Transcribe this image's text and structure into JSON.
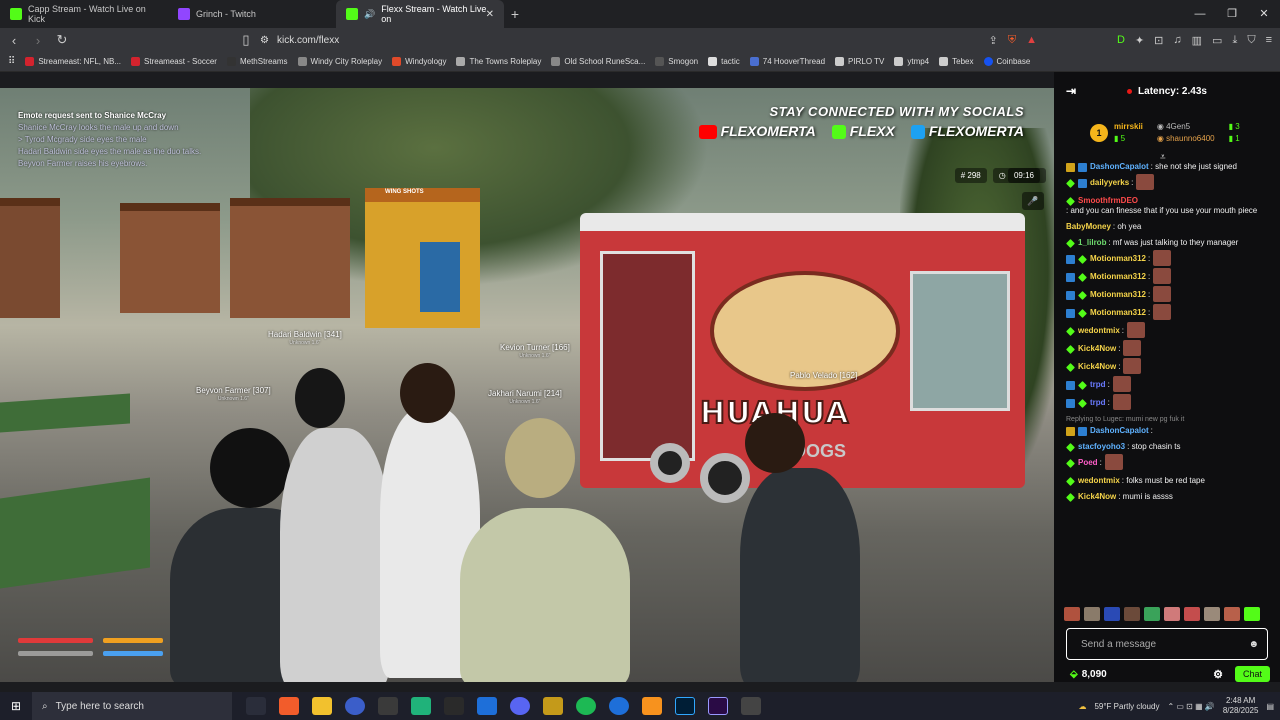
{
  "browser": {
    "tabs": [
      {
        "title": "Capp Stream - Watch Live on Kick",
        "favicon": "kick-icon"
      },
      {
        "title": "Grinch - Twitch",
        "favicon": "twitch-icon"
      },
      {
        "title": "Flexx Stream - Watch Live on",
        "favicon": "kick-icon"
      }
    ],
    "url": "kick.com/flexx",
    "bookmarks": [
      "Streameast: NFL, NB...",
      "Streameast - Soccer",
      "MethStreams",
      "Windy City Roleplay",
      "Windyology",
      "The Towns Roleplay",
      "Old School RuneSca...",
      "Smogon",
      "tactic",
      "74 HooverThread",
      "PIRLO TV",
      "ytmp4",
      "Tebex",
      "Coinbase"
    ]
  },
  "stream": {
    "notify_title": "Emote request sent to Shanice McCray",
    "notify_lines": [
      "Shanice McCray looks the male up and down",
      "> Tyrod Mcgrady side eyes the male",
      "Hadari Baldwin side eyes the male as the duo talks.",
      "Beyvon Farmer raises his eyebrows."
    ],
    "social_heading": "STAY CONNECTED WITH MY SOCIALS",
    "social_youtube": "FLEXOMERTA",
    "social_kick": "FLEXX",
    "social_x": "FLEXOMERTA",
    "hud_id": "# 298",
    "hud_time": "09:16",
    "truck_text": "HUAHUA",
    "truck_sub": "HOT DOGS",
    "kiosk_sign": "WING SHOTS",
    "name_tags": [
      {
        "name": "Hadari Baldwin [341]",
        "sub": "Unknown 1.6\""
      },
      {
        "name": "Kevion Turner [166]",
        "sub": "Unknown 1.6\""
      },
      {
        "name": "Beyvon Farmer [307]",
        "sub": "Unknown 1.6\""
      },
      {
        "name": "Jakhari Narumi [214]",
        "sub": "Unknown 1.6\""
      },
      {
        "name": "Pablo Velado [162]",
        "sub": ""
      }
    ]
  },
  "chat": {
    "latency": "Latency: 2.43s",
    "leaderboard": {
      "rank": "1",
      "user1": "mirrskii",
      "user1_count": "5",
      "user2": "4Gen5",
      "user2_count": "3",
      "user3": "shaunno6400",
      "user3_count": "1"
    },
    "messages": [
      {
        "user": "DashonCapalot",
        "text": ": she not she just signed",
        "color": "#5fb2ff",
        "badges": [
          "crown",
          "sub"
        ],
        "emote": false
      },
      {
        "user": "dailyyerks",
        "text": ":",
        "color": "#f5d44a",
        "badges": [
          "vip",
          "sub"
        ],
        "emote": true
      },
      {
        "user": "SmoothfrmDEO",
        "text": ": and you can finesse that if you use your mouth piece",
        "color": "#ff4b4b",
        "badges": [
          "vip"
        ],
        "emote": false
      },
      {
        "user": "BabyMoney",
        "text": ": oh yea",
        "color": "#f5d44a",
        "badges": [],
        "emote": false
      },
      {
        "user": "1_lilrob",
        "text": ": mf was just talking to they manager",
        "color": "#6fdc6f",
        "badges": [
          "vip"
        ],
        "emote": false
      },
      {
        "user": "Motionman312",
        "text": ":",
        "color": "#f5d44a",
        "badges": [
          "sub",
          "vip"
        ],
        "emote": true
      },
      {
        "user": "Motionman312",
        "text": ":",
        "color": "#f5d44a",
        "badges": [
          "sub",
          "vip"
        ],
        "emote": true
      },
      {
        "user": "Motionman312",
        "text": ":",
        "color": "#f5d44a",
        "badges": [
          "sub",
          "vip"
        ],
        "emote": true
      },
      {
        "user": "Motionman312",
        "text": ":",
        "color": "#f5d44a",
        "badges": [
          "sub",
          "vip"
        ],
        "emote": true
      },
      {
        "user": "wedontmix",
        "text": ":",
        "color": "#f5d44a",
        "badges": [
          "vip"
        ],
        "emote": true
      },
      {
        "user": "Kick4Now",
        "text": ":",
        "color": "#f5d44a",
        "badges": [
          "vip"
        ],
        "emote": true
      },
      {
        "user": "Kick4Now",
        "text": ":",
        "color": "#f5d44a",
        "badges": [
          "vip"
        ],
        "emote": true
      },
      {
        "user": "trpd",
        "text": ":",
        "color": "#6a7bff",
        "badges": [
          "sub",
          "vip"
        ],
        "emote": true
      },
      {
        "user": "trpd",
        "text": ":",
        "color": "#6a7bff",
        "badges": [
          "sub",
          "vip"
        ],
        "emote": true
      }
    ],
    "reply_note": "Replying to Lugec: mumi new pg fuk it",
    "messages2": [
      {
        "user": "DashonCapalot",
        "text": ":",
        "color": "#5fb2ff",
        "badges": [
          "crown",
          "sub"
        ],
        "emote": false
      },
      {
        "user": "stacfoyoho3",
        "text": ": stop chasin ts",
        "color": "#5fb2ff",
        "badges": [
          "vip"
        ],
        "emote": false
      },
      {
        "user": "Poed",
        "text": ":",
        "color": "#ff5ec8",
        "badges": [
          "vip"
        ],
        "emote": true
      },
      {
        "user": "wedontmix",
        "text": ": folks must be red tape",
        "color": "#f5d44a",
        "badges": [
          "vip"
        ],
        "emote": false
      },
      {
        "user": "Kick4Now",
        "text": ": mumi is assss",
        "color": "#f5d44a",
        "badges": [
          "vip"
        ],
        "emote": false
      }
    ],
    "input_placeholder": "Send a message",
    "points": "8,090",
    "chat_button": "Chat"
  },
  "taskbar": {
    "search_placeholder": "Type here to search",
    "weather": "59°F  Partly cloudy",
    "time": "2:48 AM",
    "date": "8/28/2025"
  },
  "colors": {
    "kick_green": "#53fc18",
    "chat_bg": "#0e0e10",
    "browser_bg": "#35363a"
  }
}
